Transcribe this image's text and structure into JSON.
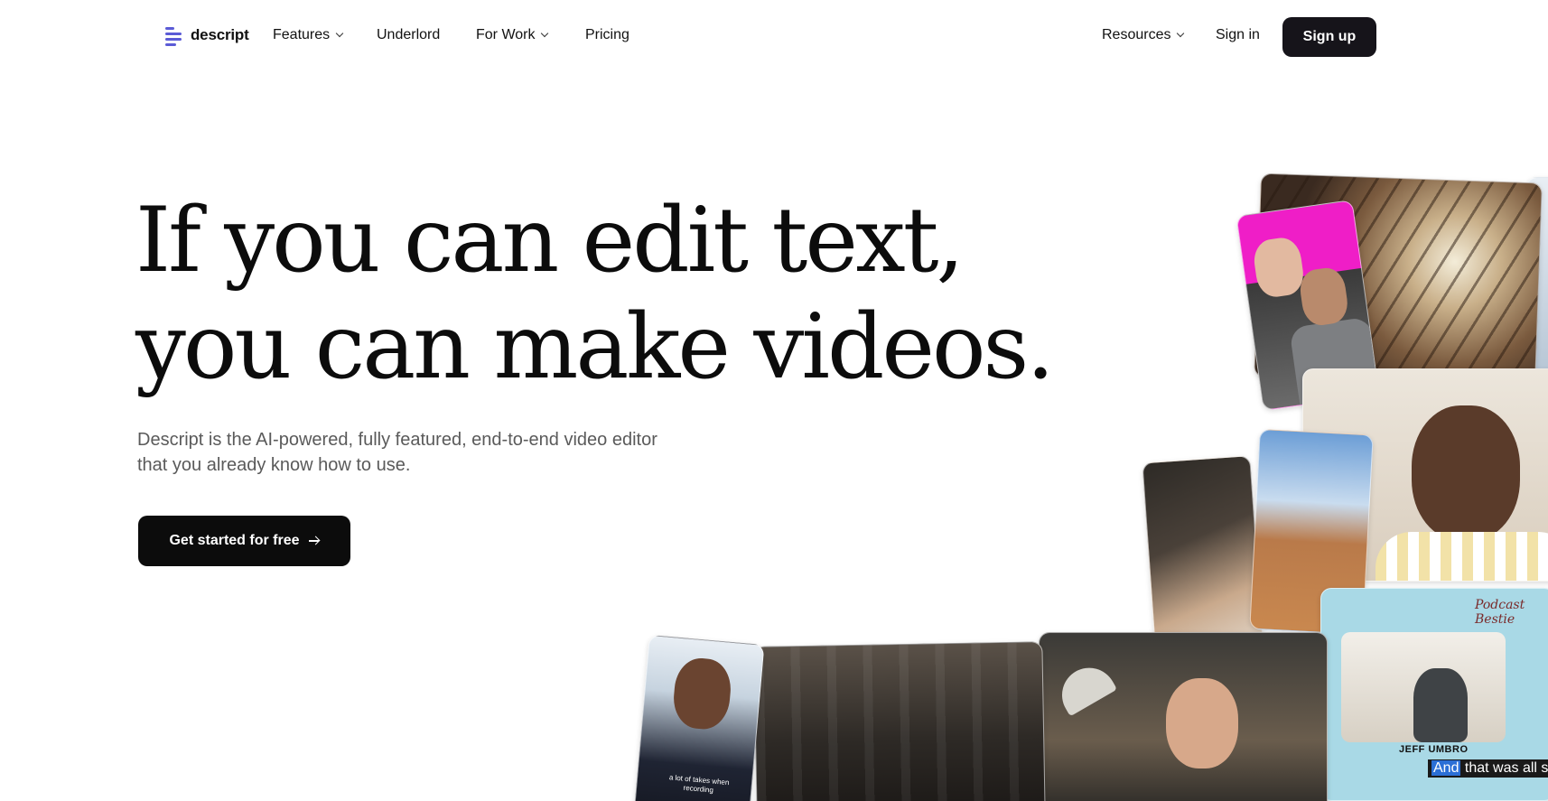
{
  "nav": {
    "logo_text": "descript",
    "features": "Features",
    "underlord": "Underlord",
    "for_work": "For Work",
    "pricing": "Pricing",
    "resources": "Resources",
    "sign_in": "Sign in",
    "sign_up": "Sign up"
  },
  "hero": {
    "headline_line1": "If you can edit text,",
    "headline_line2": "you can make videos.",
    "subhead_line1": "Descript is the AI-powered, fully featured, end-to-end video editor",
    "subhead_line2": "that you already know how to use.",
    "cta": "Get started for free"
  },
  "media": {
    "podcast_brand": "Podcast Bestie",
    "podcast_name": "JEFF UMBRO",
    "podcast_caption_highlight": "And",
    "podcast_caption_rest": " that was all sh",
    "creator_caption": "a lot of takes when recording"
  },
  "colors": {
    "brand_accent": "#5b5bd6",
    "button_dark": "#16141a",
    "cta_dark": "#0c0c0c",
    "subtext": "#5a5a5a"
  }
}
